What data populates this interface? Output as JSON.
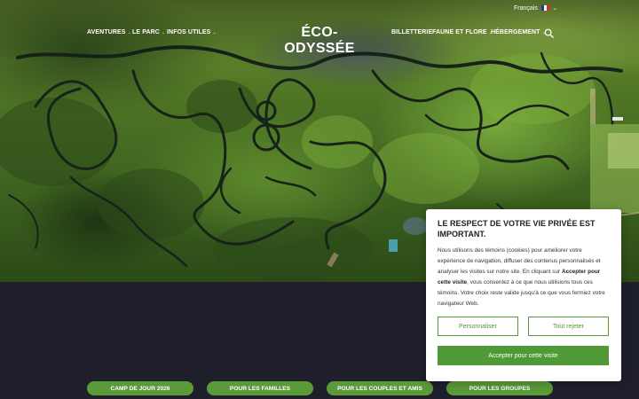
{
  "language": {
    "label": "Français",
    "flag_colors": [
      "#1f3f95",
      "#ffffff",
      "#d52b2d"
    ]
  },
  "nav": {
    "left": [
      "AVENTURES",
      "LE PARC",
      "INFOS UTILES"
    ],
    "logo": "ÉCO-ODYSSÉE",
    "right": [
      "BILLETTERIE",
      "FAUNE ET FLORE",
      "HÉBERGEMENT"
    ]
  },
  "cookie": {
    "title": "LE RESPECT DE VOTRE VIE PRIVÉE EST IMPORTANT.",
    "text_1": "Nous utilisons des témoins (cookies) pour améliorer votre expérience de navigation, diffuser des contenus personnalisés et analyser les visites sur notre site. En cliquant sur ",
    "text_bold": "Accepter pour cette visite",
    "text_2": ", vous consentez à ce que nous utilisions tous ces témoins. Votre choix reste valide jusqu'à ce que vous fermiez votre navigateur Web.",
    "customize": "Personnaliser",
    "reject": "Tout rejeter",
    "accept": "Accepter pour cette visite"
  },
  "categories": [
    "CAMP DE JOUR 2026",
    "POUR LES FAMILLES",
    "POUR LES COUPLES ET AMIS",
    "POUR LES GROUPES"
  ],
  "colors": {
    "accent": "#4f9a36",
    "pill": "#5a9a38",
    "dark_bg": "#1e1f2b"
  }
}
